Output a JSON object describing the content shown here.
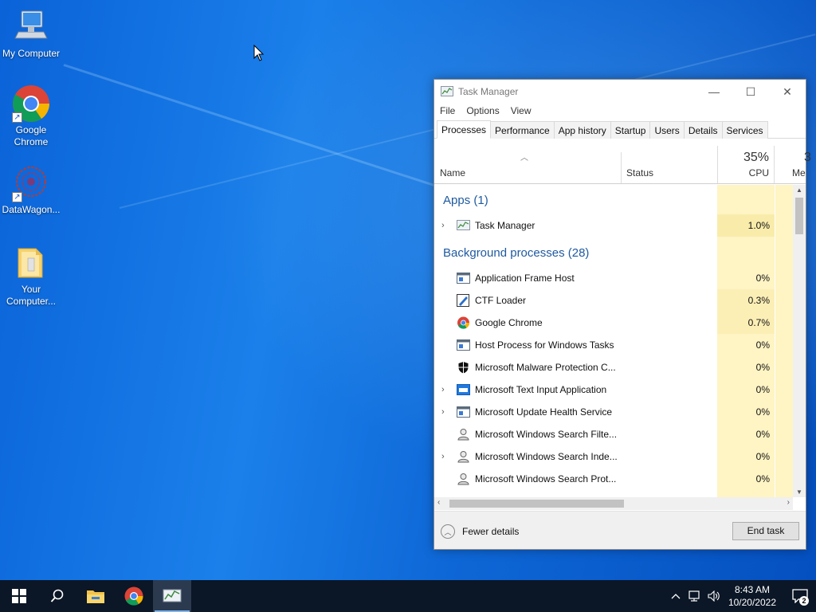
{
  "desktop": {
    "icons": [
      {
        "label": "My Computer",
        "icon": "computer-icon"
      },
      {
        "label": "Google Chrome",
        "icon": "chrome-icon"
      },
      {
        "label": "DataWagon...",
        "icon": "datawagon-icon"
      },
      {
        "label": "Your Computer...",
        "icon": "folder-icon"
      }
    ]
  },
  "taskmanager": {
    "title": "Task Manager",
    "menu": [
      "File",
      "Options",
      "View"
    ],
    "tabs": [
      "Processes",
      "Performance",
      "App history",
      "Startup",
      "Users",
      "Details",
      "Services"
    ],
    "active_tab": "Processes",
    "columns": {
      "name": "Name",
      "status": "Status",
      "cpu_pct": "35%",
      "cpu": "CPU",
      "mem_pct": "3",
      "mem": "Me"
    },
    "groups": {
      "apps": "Apps (1)",
      "background": "Background processes (28)"
    },
    "apps": [
      {
        "name": "Task Manager",
        "cpu": "1.0%",
        "icon": "task-manager-icon",
        "expandable": true
      }
    ],
    "background": [
      {
        "name": "Application Frame Host",
        "cpu": "0%",
        "icon": "window-app-icon",
        "expandable": false
      },
      {
        "name": "CTF Loader",
        "cpu": "0.3%",
        "icon": "ctf-loader-icon",
        "expandable": false
      },
      {
        "name": "Google Chrome",
        "cpu": "0.7%",
        "icon": "chrome-icon",
        "expandable": false
      },
      {
        "name": "Host Process for Windows Tasks",
        "cpu": "0%",
        "icon": "window-app-icon",
        "expandable": false
      },
      {
        "name": "Microsoft Malware Protection C...",
        "cpu": "0%",
        "icon": "shield-icon",
        "expandable": false
      },
      {
        "name": "Microsoft Text Input Application",
        "cpu": "0%",
        "icon": "text-input-icon",
        "expandable": true
      },
      {
        "name": "Microsoft Update Health Service",
        "cpu": "0%",
        "icon": "window-app-icon",
        "expandable": true
      },
      {
        "name": "Microsoft Windows Search Filte...",
        "cpu": "0%",
        "icon": "search-user-icon",
        "expandable": false
      },
      {
        "name": "Microsoft Windows Search Inde...",
        "cpu": "0%",
        "icon": "search-user-icon",
        "expandable": true
      },
      {
        "name": "Microsoft Windows Search Prot...",
        "cpu": "0%",
        "icon": "search-user-icon",
        "expandable": false
      }
    ],
    "footer": {
      "fewer_details": "Fewer details",
      "end_task": "End task"
    }
  },
  "taskbar": {
    "clock_time": "8:43 AM",
    "clock_date": "10/20/2022",
    "notification_count": "2"
  },
  "colors": {
    "cpu_highlight": "#fff4c4",
    "group_text": "#1f5aa0",
    "taskbar": "#0b1626"
  }
}
